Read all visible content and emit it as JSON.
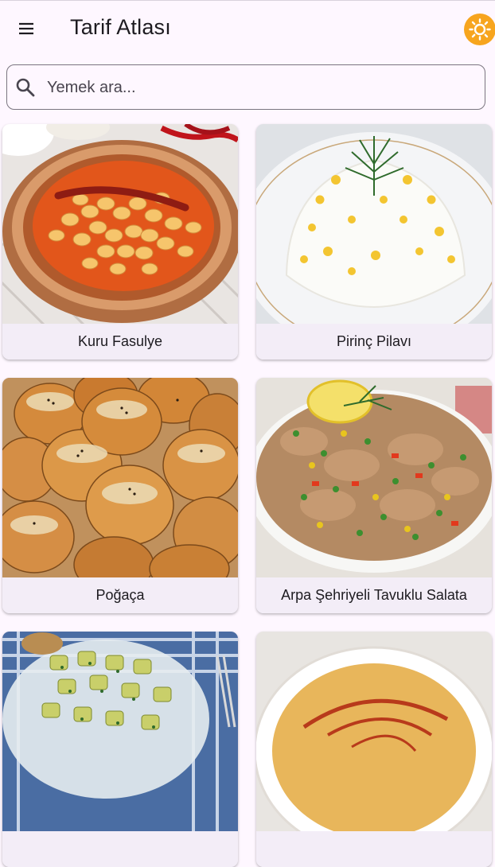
{
  "app": {
    "title": "Tarif Atlası"
  },
  "header": {
    "menu_icon": "menu-icon",
    "theme_icon": "sun-icon",
    "theme_color": "#f7a51e"
  },
  "search": {
    "placeholder": "Yemek ara...",
    "value": "",
    "icon": "search-icon"
  },
  "recipes": [
    {
      "name": "Kuru Fasulye"
    },
    {
      "name": "Pirinç Pilavı"
    },
    {
      "name": "Poğaça"
    },
    {
      "name": "Arpa Şehriyeli Tavuklu Salata"
    },
    {
      "name": ""
    },
    {
      "name": ""
    }
  ],
  "colors": {
    "background": "#fef7ff",
    "card": "#f3edf7",
    "text": "#1d1b20"
  }
}
